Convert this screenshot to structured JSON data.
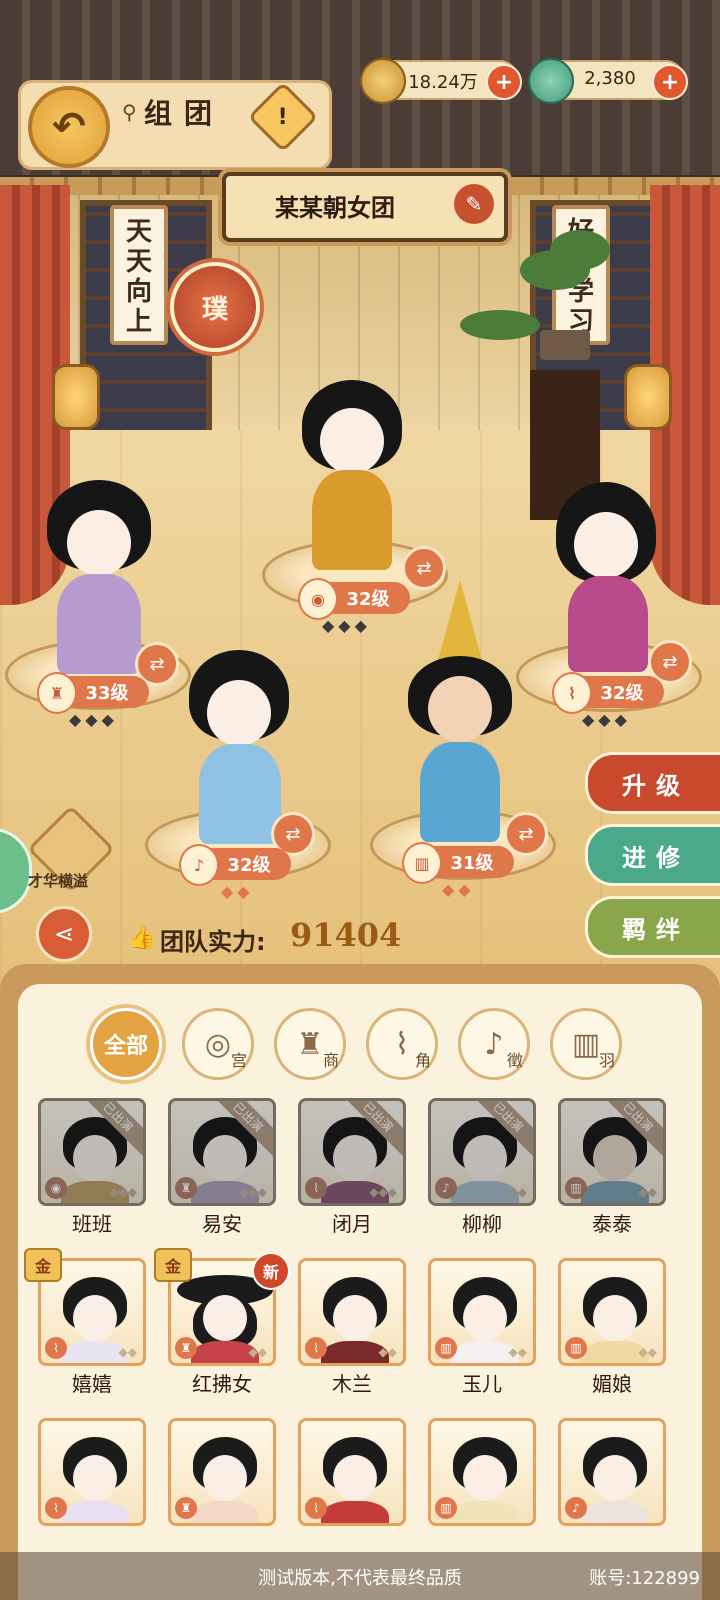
{
  "header": {
    "back_icon": "back-arrow-icon",
    "pin_icon": "location-pin-icon",
    "title": "组团",
    "hint_icon": "exclamation-icon"
  },
  "currencies": [
    {
      "icon": "coin-icon",
      "value": "18.24万",
      "add": "+"
    },
    {
      "icon": "jade-icon",
      "value": "2,380",
      "add": "+"
    }
  ],
  "team": {
    "name": "某某朝女团",
    "edit_icon": "brush-icon",
    "rank_badge": "璞",
    "scroll_left": [
      "天",
      "天",
      "向",
      "上"
    ],
    "scroll_right": [
      "好",
      "好",
      "学",
      "习"
    ]
  },
  "members": [
    {
      "level": "32级",
      "stars": "◆◆◆",
      "accent": "#d99b2e"
    },
    {
      "level": "33级",
      "stars": "◆◆◆",
      "accent": "#b79bd0"
    },
    {
      "level": "32级",
      "stars": "◆◆◆",
      "accent": "#b84a8c"
    },
    {
      "level": "32级",
      "stars": "◆◆",
      "accent": "#8ec1e3"
    },
    {
      "level": "31级",
      "stars": "◆◆",
      "accent": "#5aa6d2"
    }
  ],
  "side_buttons": [
    {
      "label": "升级",
      "color": "#c8492c"
    },
    {
      "label": "进修",
      "color": "#4aa88b"
    },
    {
      "label": "羁绊",
      "color": "#8aa64a"
    }
  ],
  "left_widgets": {
    "skill_label": "才华横溢",
    "share_icon": "share-icon"
  },
  "power": {
    "label": "团队实力:",
    "value": "91404"
  },
  "filters": [
    {
      "label": "全部",
      "icon": ""
    },
    {
      "label": "宫",
      "icon": "drum-icon"
    },
    {
      "label": "商",
      "icon": "bell-icon"
    },
    {
      "label": "角",
      "icon": "flute-icon"
    },
    {
      "label": "徵",
      "icon": "pipa-icon"
    },
    {
      "label": "羽",
      "icon": "zither-icon"
    }
  ],
  "roster": [
    {
      "name": "班班",
      "tag": "已出演",
      "accent": "#d99b2e"
    },
    {
      "name": "易安",
      "tag": "已出演",
      "accent": "#b79bd0"
    },
    {
      "name": "闭月",
      "tag": "已出演",
      "accent": "#b84a8c"
    },
    {
      "name": "柳柳",
      "tag": "已出演",
      "accent": "#8ec1e3"
    },
    {
      "name": "泰泰",
      "tag": "已出演",
      "accent": "#5aa6d2"
    },
    {
      "name": "嬉嬉",
      "badge": "金",
      "accent": "#e9e4f2"
    },
    {
      "name": "红拂女",
      "badge": "金",
      "new": "新",
      "accent": "#c7434b"
    },
    {
      "name": "木兰",
      "accent": "#7a2a2a"
    },
    {
      "name": "玉儿",
      "accent": "#f4f0f0"
    },
    {
      "name": "媚娘",
      "accent": "#f0d9a0"
    },
    {
      "name": "",
      "accent": "#e8e0f0"
    },
    {
      "name": "",
      "accent": "#f5d7c8"
    },
    {
      "name": "",
      "accent": "#c33b3b"
    },
    {
      "name": "",
      "accent": "#f1e3b8"
    },
    {
      "name": "",
      "accent": "#ece4dc"
    }
  ],
  "footer": {
    "note": "测试版本,不代表最终品质",
    "account": "账号:122899"
  }
}
